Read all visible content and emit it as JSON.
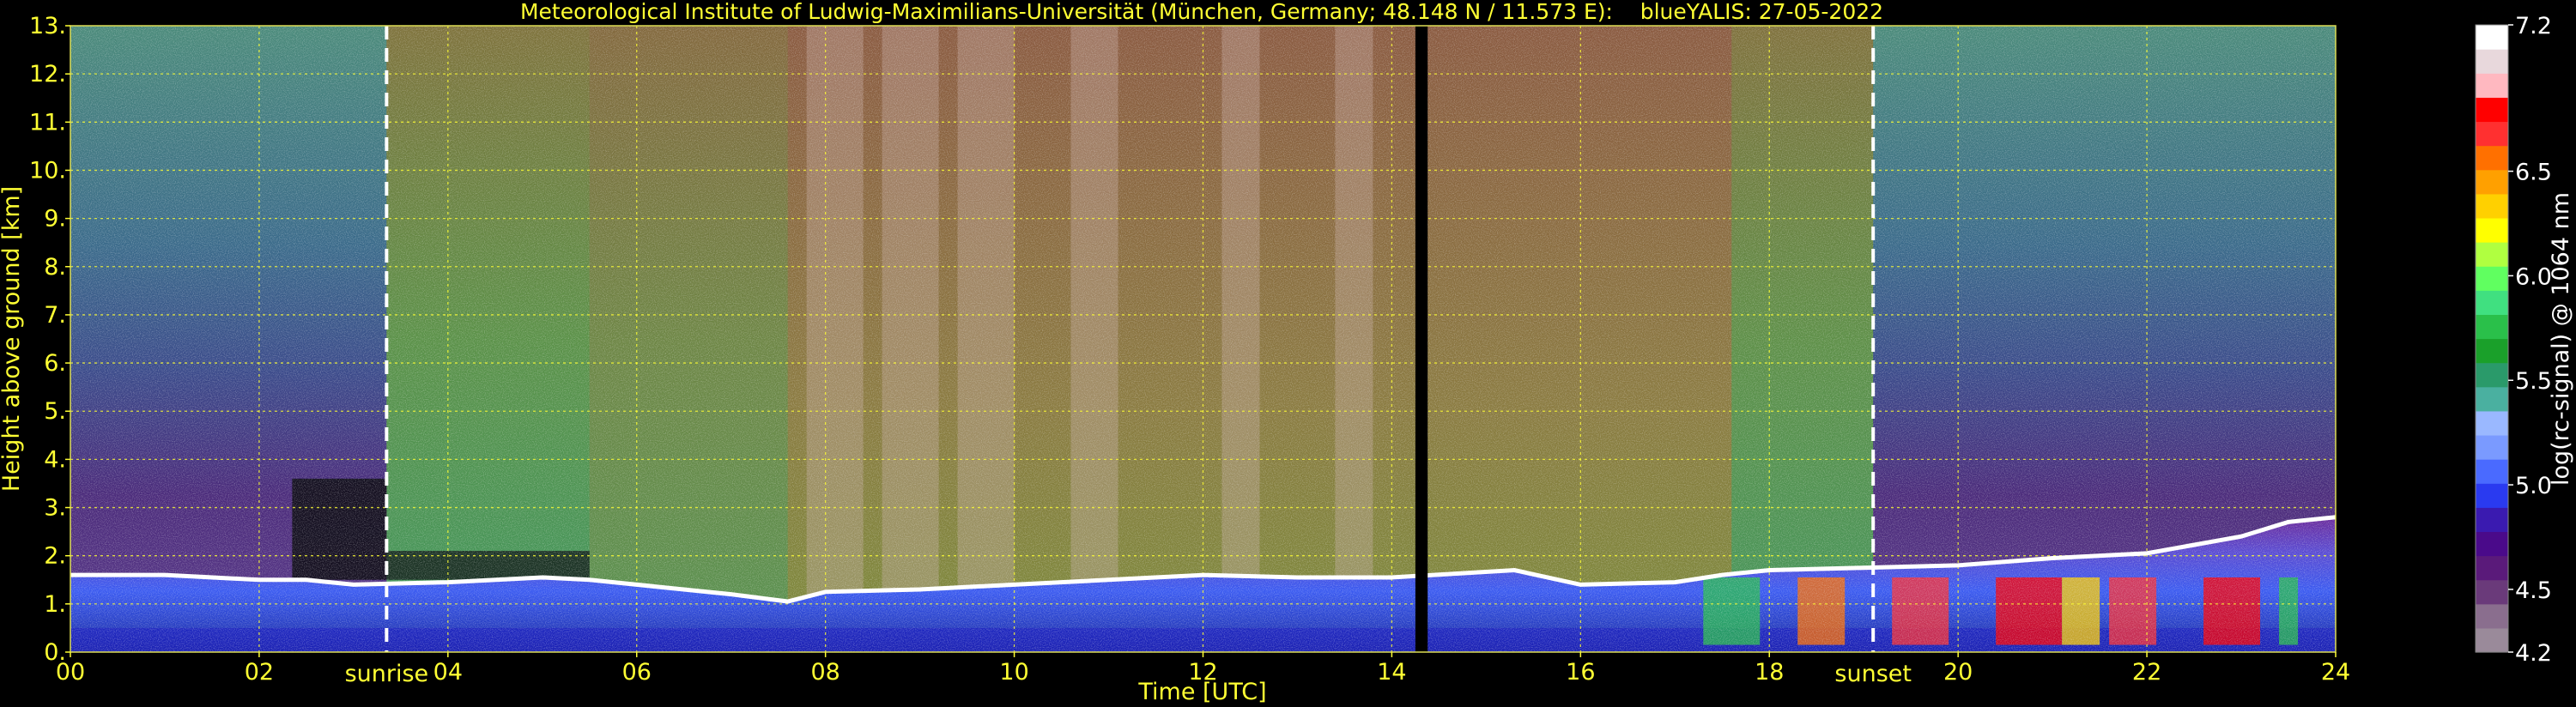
{
  "chart_data": {
    "type": "heatmap",
    "title": "Meteorological Institute of Ludwig-Maximilians-Universität (München, Germany; 48.148 N / 11.573 E):    blueYALIS: 27-05-2022",
    "xlabel": "Time [UTC]",
    "ylabel": "Height above ground [km]",
    "xlim": [
      0,
      24
    ],
    "ylim": [
      0,
      13
    ],
    "x_tick_labels": [
      "00",
      "02",
      "04",
      "06",
      "08",
      "10",
      "12",
      "14",
      "16",
      "18",
      "20",
      "22",
      "24"
    ],
    "y_tick_labels": [
      "0.",
      "1.",
      "2.",
      "3.",
      "4.",
      "5.",
      "6.",
      "7.",
      "8.",
      "9.",
      "10.",
      "11.",
      "12.",
      "13."
    ],
    "grid": true,
    "annotations": [
      {
        "label": "sunrise",
        "x": 3.35
      },
      {
        "label": "sunset",
        "x": 19.1
      }
    ],
    "data_gap": {
      "x_start": 14.25,
      "x_end": 14.38
    },
    "boundary_layer_top_km": {
      "x": [
        0,
        1,
        2,
        2.5,
        3,
        4,
        5,
        5.5,
        6,
        7,
        7.6,
        8,
        9,
        10,
        11,
        12,
        13,
        14,
        15.3,
        16,
        17,
        17.5,
        18,
        19,
        20,
        21,
        22,
        23,
        23.5,
        24
      ],
      "y": [
        1.6,
        1.6,
        1.5,
        1.5,
        1.4,
        1.45,
        1.55,
        1.5,
        1.4,
        1.2,
        1.05,
        1.25,
        1.3,
        1.4,
        1.5,
        1.6,
        1.55,
        1.55,
        1.7,
        1.4,
        1.45,
        1.6,
        1.7,
        1.75,
        1.8,
        1.95,
        2.05,
        2.4,
        2.7,
        2.8
      ]
    },
    "colorbar": {
      "label": "log(rc-signal) @ 1064 nm",
      "tick_labels": [
        "4.2",
        "4.5",
        "5.0",
        "5.5",
        "6.0",
        "6.5",
        "7.2"
      ],
      "range": [
        4.2,
        7.2
      ],
      "colors": [
        "#9a8a9a",
        "#8a6e8e",
        "#6a3a7a",
        "#5a1a7a",
        "#4a0a8a",
        "#3a1ab0",
        "#2a3af0",
        "#4a6aff",
        "#7a9aff",
        "#9ab8ff",
        "#4ab0a0",
        "#2a9a6a",
        "#1aa02a",
        "#2ac04a",
        "#40e080",
        "#60ff60",
        "#b0ff40",
        "#ffff00",
        "#ffd000",
        "#ffa000",
        "#ff7000",
        "#ff3030",
        "#ff0000",
        "#ffb8c0",
        "#e8d8dc",
        "#ffffff"
      ]
    }
  }
}
